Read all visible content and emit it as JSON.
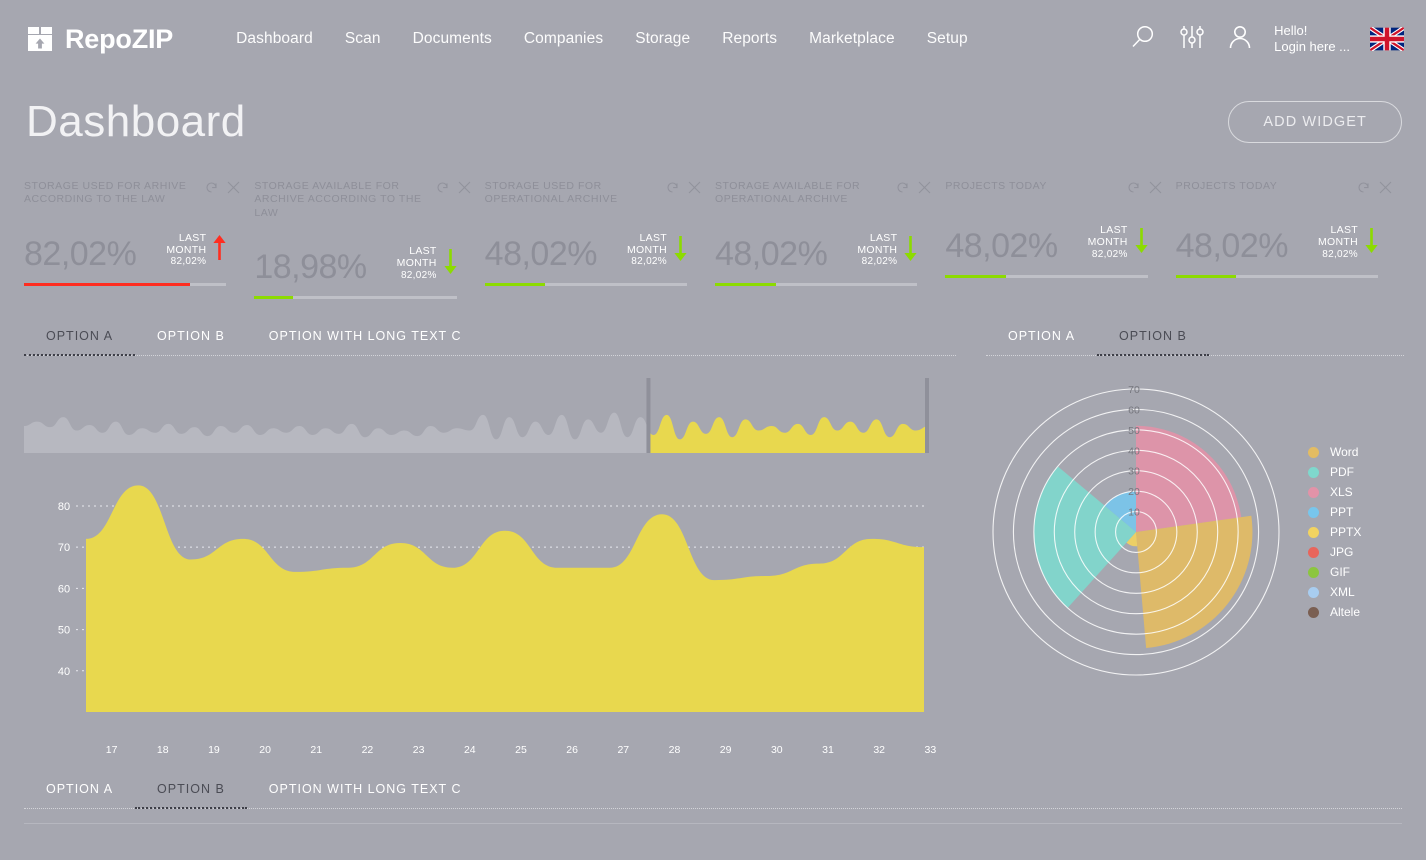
{
  "brand": {
    "name": "RepoZIP",
    "logo_icon": "archive-box-upload-icon"
  },
  "nav": {
    "items": [
      {
        "label": "Dashboard"
      },
      {
        "label": "Scan"
      },
      {
        "label": "Documents"
      },
      {
        "label": "Companies"
      },
      {
        "label": "Storage"
      },
      {
        "label": "Reports"
      },
      {
        "label": "Marketplace"
      },
      {
        "label": "Setup"
      }
    ]
  },
  "topright": {
    "search_icon": "search-icon",
    "settings_icon": "sliders-icon",
    "account_icon": "user-icon",
    "greeting": "Hello!",
    "login_prompt": "Login here ...",
    "flag_icon": "uk-flag-icon"
  },
  "header": {
    "title": "Dashboard",
    "add_widget_label": "ADD WIDGET"
  },
  "cards": [
    {
      "title": "STORAGE USED FOR ARHIVE ACCORDING TO THE LAW",
      "value": "82,02%",
      "meta_line1": "LAST",
      "meta_line2": "MONTH",
      "meta_value": "82,02%",
      "trend": "up",
      "trend_color": "#ff2d20",
      "bar_color": "#ff2d20",
      "bar_percent": 82,
      "refresh_icon": "refresh-icon",
      "close_icon": "close-icon"
    },
    {
      "title": "STORAGE AVAILABLE FOR ARCHIVE ACCORDING TO THE LAW",
      "value": "18,98%",
      "meta_line1": "LAST",
      "meta_line2": "MONTH",
      "meta_value": "82,02%",
      "trend": "down",
      "trend_color": "#8cdb00",
      "bar_color": "#8cdb00",
      "bar_percent": 19,
      "refresh_icon": "refresh-icon",
      "close_icon": "close-icon"
    },
    {
      "title": "STORAGE USED FOR OPERATIONAL ARCHIVE",
      "value": "48,02%",
      "meta_line1": "LAST",
      "meta_line2": "MONTH",
      "meta_value": "82,02%",
      "trend": "down",
      "trend_color": "#8cdb00",
      "bar_color": "#8cdb00",
      "bar_percent": 30,
      "refresh_icon": "refresh-icon",
      "close_icon": "close-icon"
    },
    {
      "title": "STORAGE AVAILABLE FOR OPERATIONAL ARCHIVE",
      "value": "48,02%",
      "meta_line1": "LAST",
      "meta_line2": "MONTH",
      "meta_value": "82,02%",
      "trend": "down",
      "trend_color": "#8cdb00",
      "bar_color": "#8cdb00",
      "bar_percent": 30,
      "refresh_icon": "refresh-icon",
      "close_icon": "close-icon"
    },
    {
      "title": "PROJECTS TODAY",
      "value": "48,02%",
      "meta_line1": "LAST",
      "meta_line2": "MONTH",
      "meta_value": "82,02%",
      "trend": "down",
      "trend_color": "#8cdb00",
      "bar_color": "#8cdb00",
      "bar_percent": 30,
      "refresh_icon": "refresh-icon",
      "close_icon": "close-icon"
    },
    {
      "title": "PROJECTS TODAY",
      "value": "48,02%",
      "meta_line1": "LAST",
      "meta_line2": "MONTH",
      "meta_value": "82,02%",
      "trend": "down",
      "trend_color": "#8cdb00",
      "bar_color": "#8cdb00",
      "bar_percent": 30,
      "refresh_icon": "refresh-icon",
      "close_icon": "close-icon"
    }
  ],
  "left_tabs": {
    "items": [
      {
        "label": "OPTION A",
        "active": true
      },
      {
        "label": "OPTION B",
        "active": false
      },
      {
        "label": "OPTION WITH LONG TEXT C",
        "active": false
      }
    ]
  },
  "right_tabs": {
    "items": [
      {
        "label": "OPTION A",
        "active": false
      },
      {
        "label": "OPTION B",
        "active": true
      }
    ]
  },
  "bottom_tabs": {
    "items": [
      {
        "label": "OPTION A",
        "active": false
      },
      {
        "label": "OPTION B",
        "active": true
      },
      {
        "label": "OPTION WITH LONG TEXT C",
        "active": false
      }
    ]
  },
  "colors": {
    "page_bg": "#a6a7b0",
    "accent_yellow": "#e8d84e",
    "brush_area": "#b7b8c0",
    "brush_selection": "#e8d84e",
    "grid": "#e8e8ee"
  },
  "chart_data": [
    {
      "type": "area",
      "name": "main-area-chart",
      "title": "",
      "xlabel": "",
      "ylabel": "",
      "x": [
        17,
        18,
        19,
        20,
        21,
        22,
        23,
        24,
        25,
        26,
        27,
        28,
        29,
        30,
        31,
        32,
        33
      ],
      "values": [
        72,
        85,
        67,
        72,
        64,
        65,
        71,
        65,
        74,
        65,
        65,
        78,
        62,
        63,
        66,
        72,
        70
      ],
      "xlim": [
        17,
        33
      ],
      "ylim": [
        30,
        88
      ],
      "yticks": [
        40,
        50,
        60,
        70,
        80
      ],
      "xticks": [
        "17",
        "18",
        "19",
        "20",
        "21",
        "22",
        "23",
        "24",
        "25",
        "26",
        "27",
        "28",
        "29",
        "30",
        "31",
        "32",
        "33"
      ],
      "grid": true,
      "legend": "none",
      "fill_color": "#e8d84e"
    },
    {
      "type": "area",
      "name": "range-brush-overview",
      "title": "",
      "values": [
        62,
        66,
        61,
        70,
        58,
        63,
        56,
        66,
        54,
        60,
        56,
        64,
        55,
        61,
        53,
        62,
        56,
        63,
        54,
        60,
        56,
        62,
        54,
        60,
        55,
        64,
        52,
        60,
        54,
        58,
        53,
        62,
        56,
        60,
        58,
        72,
        50,
        70,
        52,
        66,
        54,
        72,
        50,
        68,
        56,
        74,
        52,
        70,
        54,
        72,
        50,
        66,
        55,
        70,
        52,
        68,
        58,
        62,
        56,
        64,
        54,
        70,
        58,
        66,
        56,
        68,
        52,
        64,
        58,
        62
      ],
      "selection_start_percent": 69,
      "selection_end_percent": 100,
      "grid": false,
      "legend": "none"
    },
    {
      "type": "pie",
      "name": "polar-rose-chart",
      "title": "",
      "rticks": [
        10,
        20,
        30,
        40,
        50,
        60,
        70
      ],
      "rlim": [
        0,
        70
      ],
      "legend": "right",
      "categories": [
        "Word",
        "PDF",
        "XLS",
        "PPT",
        "PPTX",
        "JPG",
        "GIF",
        "XML",
        "Altele"
      ],
      "colors": [
        "#e3bc63",
        "#7fd8cd",
        "#e293a8",
        "#78c6ec",
        "#f2d360",
        "#e8655c",
        "#8cc63f",
        "#a8cdf0",
        "#7a5f52"
      ],
      "values": [
        57,
        50,
        52,
        20,
        7,
        0,
        0,
        0,
        0
      ],
      "sectors": [
        {
          "name": "XLS",
          "color": "#e293a8",
          "value": 52,
          "start_deg": 0,
          "end_deg": 82
        },
        {
          "name": "Word",
          "color": "#e3bc63",
          "value": 57,
          "start_deg": 82,
          "end_deg": 175
        },
        {
          "name": "PPTX",
          "color": "#f2d360",
          "value": 7,
          "start_deg": 175,
          "end_deg": 222
        },
        {
          "name": "PDF",
          "color": "#7fd8cd",
          "value": 50,
          "start_deg": 222,
          "end_deg": 310
        },
        {
          "name": "PPT",
          "color": "#78c6ec",
          "value": 20,
          "start_deg": 310,
          "end_deg": 360
        }
      ]
    }
  ],
  "legend": {
    "items": [
      {
        "label": "Word",
        "color": "#e3bc63"
      },
      {
        "label": "PDF",
        "color": "#7fd8cd"
      },
      {
        "label": "XLS",
        "color": "#e293a8"
      },
      {
        "label": "PPT",
        "color": "#78c6ec"
      },
      {
        "label": "PPTX",
        "color": "#f2d360"
      },
      {
        "label": "JPG",
        "color": "#e8655c"
      },
      {
        "label": "GIF",
        "color": "#8cc63f"
      },
      {
        "label": "XML",
        "color": "#a8cdf0"
      },
      {
        "label": "Altele",
        "color": "#7a5f52"
      }
    ]
  }
}
